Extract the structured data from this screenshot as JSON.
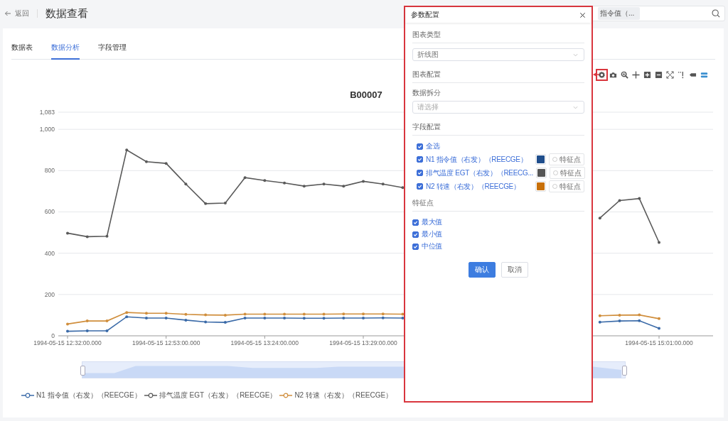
{
  "header": {
    "back": "返回",
    "title": "数据查看"
  },
  "search": {
    "tag": "指令值（..."
  },
  "tabs": [
    {
      "label": "数据表",
      "selected": false
    },
    {
      "label": "数据分析",
      "selected": true
    },
    {
      "label": "字段管理",
      "selected": false
    }
  ],
  "toolbar": [
    {
      "kind": "gear",
      "highlighted": true
    },
    {
      "kind": "camera",
      "highlighted": false
    },
    {
      "kind": "zoom",
      "highlighted": false
    },
    {
      "kind": "pan",
      "highlighted": false
    },
    {
      "kind": "plus",
      "highlighted": false
    },
    {
      "kind": "minus",
      "highlighted": false
    },
    {
      "kind": "autoscale",
      "highlighted": false
    },
    {
      "kind": "spike",
      "highlighted": false
    },
    {
      "kind": "tag",
      "highlighted": false
    },
    {
      "kind": "compare",
      "highlighted": false
    }
  ],
  "chart": {
    "zoom": {
      "level": 1
    },
    "chart_data": {
      "type": "line",
      "title": "B00007",
      "ylim": [
        0,
        1083
      ],
      "grid": true,
      "yticks": [
        0,
        200,
        400,
        600,
        800,
        {
          "value": 1000,
          "label": "1,000"
        },
        {
          "value": 1083,
          "label": "1,083"
        }
      ],
      "categories": [
        "1994-05-15 12:32:00.000",
        null,
        null,
        null,
        null,
        "1994-05-15 12:53:00.000",
        null,
        null,
        null,
        null,
        "1994-05-15 13:24:00.000",
        null,
        null,
        null,
        null,
        "1994-05-15 13:29:00.000",
        null,
        null,
        null,
        null,
        null,
        null,
        null,
        null,
        null,
        null,
        null,
        null,
        null,
        null,
        "1994-05-15 15:01:00.000"
      ],
      "series": [
        {
          "name": "N1 指令值（右发）（REECGE）",
          "color": "#3a6aa8",
          "values": [
            22,
            24,
            24,
            92,
            86,
            86,
            76,
            67,
            65,
            86,
            86,
            86,
            85,
            85,
            86,
            86,
            87,
            86,
            null,
            null,
            null,
            null,
            null,
            null,
            null,
            null,
            null,
            66,
            72,
            73,
            36
          ]
        },
        {
          "name": "排气温度 EGT（右发）（REECGE）",
          "color": "#5a5a5a",
          "values": [
            497,
            480,
            482,
            900,
            843,
            835,
            735,
            640,
            643,
            766,
            752,
            740,
            725,
            735,
            725,
            748,
            735,
            718,
            null,
            null,
            null,
            null,
            null,
            null,
            null,
            null,
            null,
            570,
            655,
            665,
            452
          ]
        },
        {
          "name": "N2 转速（右发）（REECGE）",
          "color": "#d08e3c",
          "values": [
            57,
            72,
            72,
            113,
            109,
            109,
            104,
            101,
            100,
            105,
            105,
            105,
            105,
            105,
            106,
            106,
            106,
            105,
            null,
            null,
            null,
            null,
            null,
            null,
            null,
            null,
            null,
            97,
            100,
            101,
            83
          ]
        }
      ]
    }
  },
  "dialog": {
    "title": "参数配置",
    "chart_type": {
      "heading": "图表类型",
      "value": "折线图"
    },
    "chart_config": {
      "heading": "图表配置",
      "split_label": "数据拆分",
      "split_placeholder": "请选择"
    },
    "field_config": {
      "heading": "字段配置",
      "select_all": {
        "label": "全选",
        "checked": true
      },
      "fields": [
        {
          "label": "N1 指令值（右发）（REECGE）",
          "checked": true,
          "color": "#1f4e8c",
          "feature": {
            "label": "特征点",
            "selected": false
          }
        },
        {
          "label": "排气温度 EGT（右发）（REECG...",
          "checked": true,
          "color": "#555555",
          "feature": {
            "label": "特征点",
            "selected": false
          }
        },
        {
          "label": "N2 转速（右发）（REECGE）",
          "checked": true,
          "color": "#c8700a",
          "feature": {
            "label": "特征点",
            "selected": false
          }
        }
      ]
    },
    "feature_points": {
      "heading": "特征点",
      "options": [
        {
          "label": "最大值",
          "checked": true
        },
        {
          "label": "最小值",
          "checked": true
        },
        {
          "label": "中位值",
          "checked": true
        }
      ]
    },
    "buttons": [
      {
        "label": "确认",
        "kind": "primary"
      },
      {
        "label": "取消",
        "kind": "default"
      }
    ]
  }
}
